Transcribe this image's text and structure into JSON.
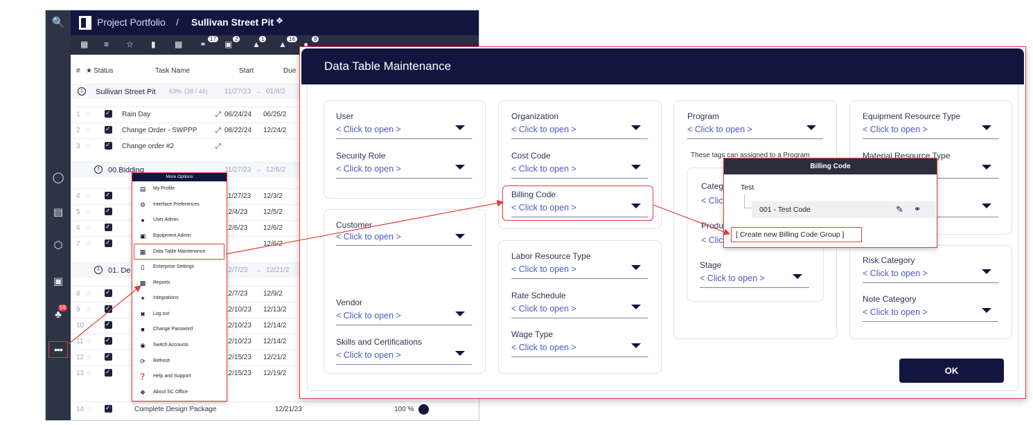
{
  "app": {
    "breadcrumb_root": "Project Portfolio",
    "breadcrumb_sep": "/",
    "page_title": "Sullivan Street Pit",
    "rail_badge": "59",
    "toolbar_badges": [
      "17",
      "2",
      "1",
      "16",
      "8"
    ]
  },
  "grid": {
    "headers": [
      "#",
      "★",
      "Status",
      "Task Name",
      "Start",
      "Due"
    ],
    "project_row": {
      "name": "Sullivan Street Pit",
      "pct": "63%",
      "count": "(28 / 44)",
      "start": "11/27/23",
      "arrow": "→",
      "due": "01/8/2"
    },
    "rows": [
      {
        "num": "1",
        "name": "Rain Day",
        "start": "06/24/24",
        "due": "06/25/2"
      },
      {
        "num": "2",
        "name": "Change Order - SWPPP",
        "start": "08/22/24",
        "due": "12/24/2"
      },
      {
        "num": "3",
        "name": "Change order #2",
        "start": "",
        "due": ""
      }
    ],
    "group1": {
      "name": "00.Bidding",
      "start": "11/27/23",
      "arrow": "→",
      "due": "12/6/2"
    },
    "group1_rows": [
      {
        "num": "4",
        "start": "11/27/23",
        "due": "12/3/2"
      },
      {
        "num": "5",
        "start": "12/4/23",
        "due": "12/5/2"
      },
      {
        "num": "6",
        "start": "12/6/23",
        "due": "12/6/2"
      },
      {
        "num": "7",
        "start": "",
        "due": "12/6/2"
      }
    ],
    "group2": {
      "name": "01. De",
      "start": "12/7/23",
      "arrow": "→",
      "due": "12/21/2"
    },
    "group2_rows": [
      {
        "num": "8",
        "start": "12/7/23",
        "due": "12/9/2"
      },
      {
        "num": "9",
        "start": "12/10/23",
        "due": "12/13/2"
      },
      {
        "num": "10",
        "start": "12/10/23",
        "due": "12/14/2"
      },
      {
        "num": "11",
        "start": "12/10/23",
        "due": "12/14/2"
      },
      {
        "num": "12",
        "start": "12/15/23",
        "due": "12/21/2"
      },
      {
        "num": "13",
        "start": "12/15/23",
        "due": "12/19/2"
      }
    ],
    "last_row": {
      "num": "14",
      "name": "Complete Design Package",
      "due": "12/21/23",
      "pct": "100 %"
    }
  },
  "menu": {
    "title": "More Options",
    "items": [
      {
        "label": "My Profile",
        "icon": "id-card-icon"
      },
      {
        "label": "Interface Preferences",
        "icon": "gear-icon"
      },
      {
        "label": "User Admin",
        "icon": "user-icon"
      },
      {
        "label": "Equipment Admin",
        "icon": "truck-icon"
      },
      {
        "label": "Data Table Maintenance",
        "icon": "table-icon"
      },
      {
        "label": "Enterprise Settings",
        "icon": "document-icon"
      },
      {
        "label": "Reports",
        "icon": "chart-icon"
      },
      {
        "label": "Integrations",
        "icon": "plug-icon"
      },
      {
        "label": "Log out",
        "icon": "logout-icon"
      },
      {
        "label": "Change Password",
        "icon": "lock-icon"
      },
      {
        "label": "Switch Accounts",
        "icon": "users-icon"
      },
      {
        "label": "Refresh",
        "icon": "refresh-icon"
      },
      {
        "label": "Help and Support",
        "icon": "help-icon"
      },
      {
        "label": "About SC Office",
        "icon": "info-icon"
      }
    ]
  },
  "dialog": {
    "title": "Data Table Maintenance",
    "placeholder": "< Click to open >",
    "fields": {
      "user": "User",
      "security_role": "Security Role",
      "customer": "Customer",
      "vendor": "Vendor",
      "skills": "Skills and Certifications",
      "organization": "Organization",
      "cost_code": "Cost Code",
      "billing_code": "Billing Code",
      "labor_resource_type": "Labor Resource Type",
      "rate_schedule": "Rate Schedule",
      "wage_type": "Wage Type",
      "program": "Program",
      "program_note": "These tags can assigned to a Program",
      "category_partial": "Categ",
      "product_partial": "Produ",
      "stage": "Stage",
      "equipment_resource_type": "Equipment Resource Type",
      "material_resource_type": "Material Resource Type",
      "risk_category": "Risk Category",
      "note_category": "Note Category",
      "clic_partial": "< Clic"
    },
    "ok_label": "OK"
  },
  "billing_popup": {
    "title": "Billing Code",
    "group_name": "Test",
    "item": "001 - Test Code",
    "create_link": "[ Create new Billing Code Group ]"
  }
}
